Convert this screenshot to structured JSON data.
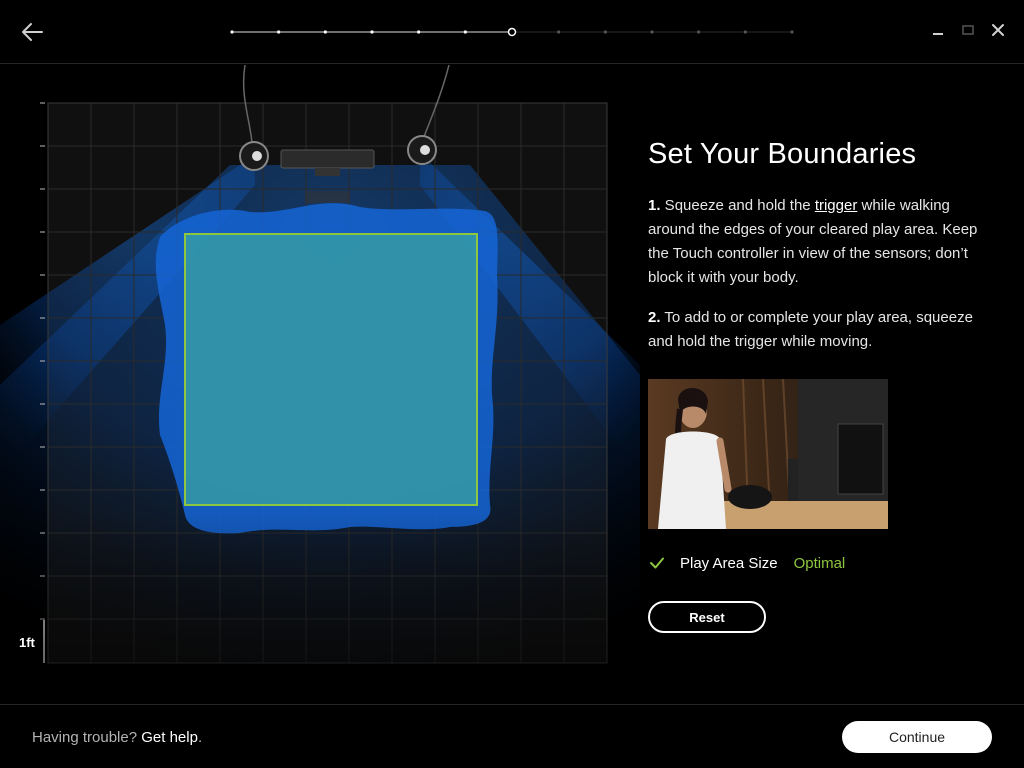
{
  "header": {
    "back_icon": "back-arrow-icon",
    "progress": {
      "total_steps": 13,
      "current_step": 7
    },
    "window_controls": [
      "minimize-icon",
      "maximize-icon",
      "close-icon"
    ]
  },
  "scene": {
    "scale_label": "1ft",
    "colors": {
      "tracking": "#0a5fd0",
      "play_area_fill": "#3aa3a0",
      "play_area_border": "#8ec63f"
    }
  },
  "panel": {
    "title": "Set Your Boundaries",
    "step1": {
      "number": "1.",
      "text_before": " Squeeze and hold the ",
      "link": "trigger",
      "text_after": " while walking around the edges of your cleared play area. Keep the Touch controller in view of the sensors; don’t block it with your body."
    },
    "step2": {
      "number": "2.",
      "text": " To add to or complete your play area, squeeze and hold the trigger while moving."
    },
    "status": {
      "label": "Play Area Size",
      "value": "Optimal",
      "value_color": "#8ec63f"
    },
    "reset_label": "Reset"
  },
  "footer": {
    "help_prefix": "Having trouble? ",
    "help_link": "Get help",
    "help_suffix": ".",
    "continue_label": "Continue"
  }
}
